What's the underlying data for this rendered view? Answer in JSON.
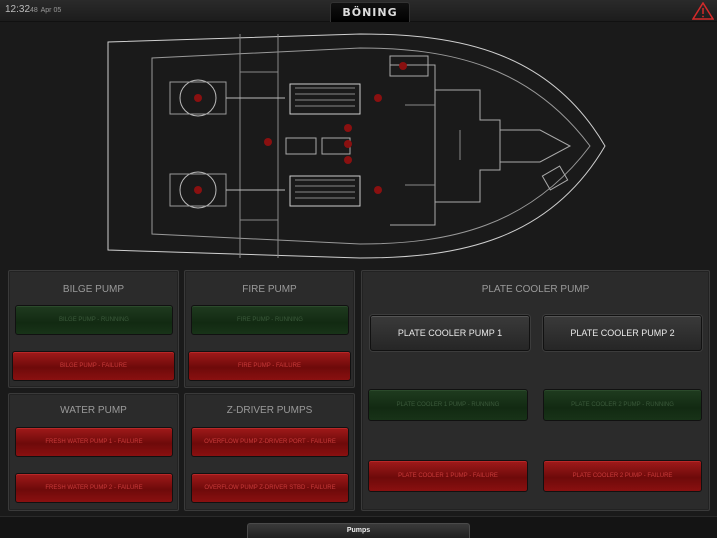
{
  "header": {
    "time": "12:32",
    "seconds": "48",
    "date": "Apr 05",
    "logo": "BÖNING"
  },
  "panels": {
    "bilge": {
      "title": "BILGE PUMP",
      "running": "BILGE PUMP - RUNNING",
      "failure": "BILGE PUMP - FAILURE"
    },
    "fire": {
      "title": "FIRE PUMP",
      "running": "FIRE PUMP - RUNNING",
      "failure": "FIRE PUMP - FAILURE"
    },
    "water": {
      "title": "WATER PUMP",
      "pump1": "FRESH WATER PUMP 1 - FAILURE",
      "pump2": "FRESH WATER PUMP 2 - FAILURE"
    },
    "zdrive": {
      "title": "Z-DRIVER PUMPS",
      "pump1": "OVERFLOW PUMP Z-DRIVER PORT - FAILURE",
      "pump2": "OVERFLOW PUMP Z-DRIVER STBD - FAILURE"
    },
    "plate": {
      "title": "PLATE COOLER PUMP",
      "button1": "PLATE COOLER PUMP 1",
      "button2": "PLATE COOLER PUMP 2",
      "running1": "PLATE COOLER 1 PUMP - RUNNING",
      "running2": "PLATE COOLER 2 PUMP - RUNNING",
      "failure1": "PLATE COOLER 1 PUMP - FAILURE",
      "failure2": "PLATE COOLER 2 PUMP - FAILURE"
    }
  },
  "footer": {
    "tab_label": "Pumps"
  },
  "colors": {
    "background": "#1a1a1a",
    "running": "#1f3b1f",
    "failure": "#a01a1a",
    "alarm": "#d42a2a",
    "outline": "#cfcfcf"
  },
  "icons": {
    "alarm": "warning-triangle-icon"
  }
}
